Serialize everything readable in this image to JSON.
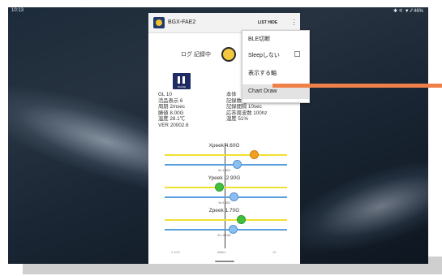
{
  "statusbar": {
    "time": "10:13",
    "right": "✱ ⚟ ▼ ⁄⁄ 46%"
  },
  "app": {
    "title": "BGX-FAE2",
    "list_hide": "LIST HIDE",
    "log_status": "ログ 記録中",
    "pause_label": "PAUSE",
    "info_left": [
      "GL 10",
      "活品表示 6",
      "周期 2msec",
      "勝値 8.00G",
      "温度 28.1℃",
      "VER 20002.6"
    ],
    "info_right": [
      "本体",
      "記録数 34606",
      "記録間隔 10sec",
      "応答周波数 100hz",
      "湿度 51%"
    ],
    "chart": {
      "xpeak_label": "Xpeek 4.60G",
      "x_small": "Xo 1.50G",
      "ypeak_label": "Ypeek -2.90G",
      "y_small": "Yo 0.00G",
      "zpeak_label": "Zpeek 1.70G",
      "z_small": "Zo -0.10G",
      "bottom_left": "± 10G",
      "bottom_center": "-8kBm",
      "bottom_right": "10"
    }
  },
  "menu": {
    "items": [
      "BLE切断",
      "Sleepしない",
      "表示する軸",
      "Chart Draw"
    ]
  },
  "colors": {
    "accent_arrow": "#f0804a",
    "yellow_track": "#f0e030",
    "blue_track": "#5aa0e0"
  }
}
